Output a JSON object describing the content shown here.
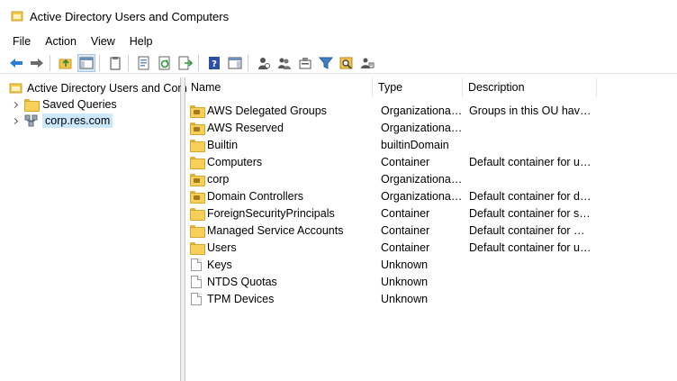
{
  "window": {
    "title": "Active Directory Users and Computers"
  },
  "menu": [
    "File",
    "Action",
    "View",
    "Help"
  ],
  "toolbar": {
    "buttons": [
      "back-icon",
      "forward-icon",
      "up-folder-icon",
      "show-hide-console-tree-icon",
      "clipboard-icon",
      "properties-icon",
      "refresh-icon",
      "export-list-icon",
      "help-icon",
      "action-pane-icon",
      "new-user-icon",
      "new-group-icon",
      "new-ou-icon",
      "filter-icon",
      "find-icon",
      "delegate-control-icon"
    ]
  },
  "tree": {
    "root": "Active Directory Users and Com",
    "saved_queries": "Saved Queries",
    "domain": "corp.res.com"
  },
  "list": {
    "columns": {
      "name": "Name",
      "type": "Type",
      "description": "Description"
    },
    "rows": [
      {
        "icon": "ou-folder-icon",
        "name": "AWS Delegated Groups",
        "type": "Organizational...",
        "description": "Groups in this OU have ..."
      },
      {
        "icon": "ou-folder-icon",
        "name": "AWS Reserved",
        "type": "Organizational...",
        "description": ""
      },
      {
        "icon": "folder-icon",
        "name": "Builtin",
        "type": "builtinDomain",
        "description": ""
      },
      {
        "icon": "folder-icon",
        "name": "Computers",
        "type": "Container",
        "description": "Default container for up..."
      },
      {
        "icon": "ou-folder-icon",
        "name": "corp",
        "type": "Organizational...",
        "description": ""
      },
      {
        "icon": "ou-folder-icon",
        "name": "Domain Controllers",
        "type": "Organizational...",
        "description": "Default container for do..."
      },
      {
        "icon": "folder-icon",
        "name": "ForeignSecurityPrincipals",
        "type": "Container",
        "description": "Default container for sec..."
      },
      {
        "icon": "folder-icon",
        "name": "Managed Service Accounts",
        "type": "Container",
        "description": "Default container for ma..."
      },
      {
        "icon": "folder-icon",
        "name": "Users",
        "type": "Container",
        "description": "Default container for up..."
      },
      {
        "icon": "document-icon",
        "name": "Keys",
        "type": "Unknown",
        "description": ""
      },
      {
        "icon": "document-icon",
        "name": "NTDS Quotas",
        "type": "Unknown",
        "description": ""
      },
      {
        "icon": "document-icon",
        "name": "TPM Devices",
        "type": "Unknown",
        "description": ""
      }
    ]
  }
}
